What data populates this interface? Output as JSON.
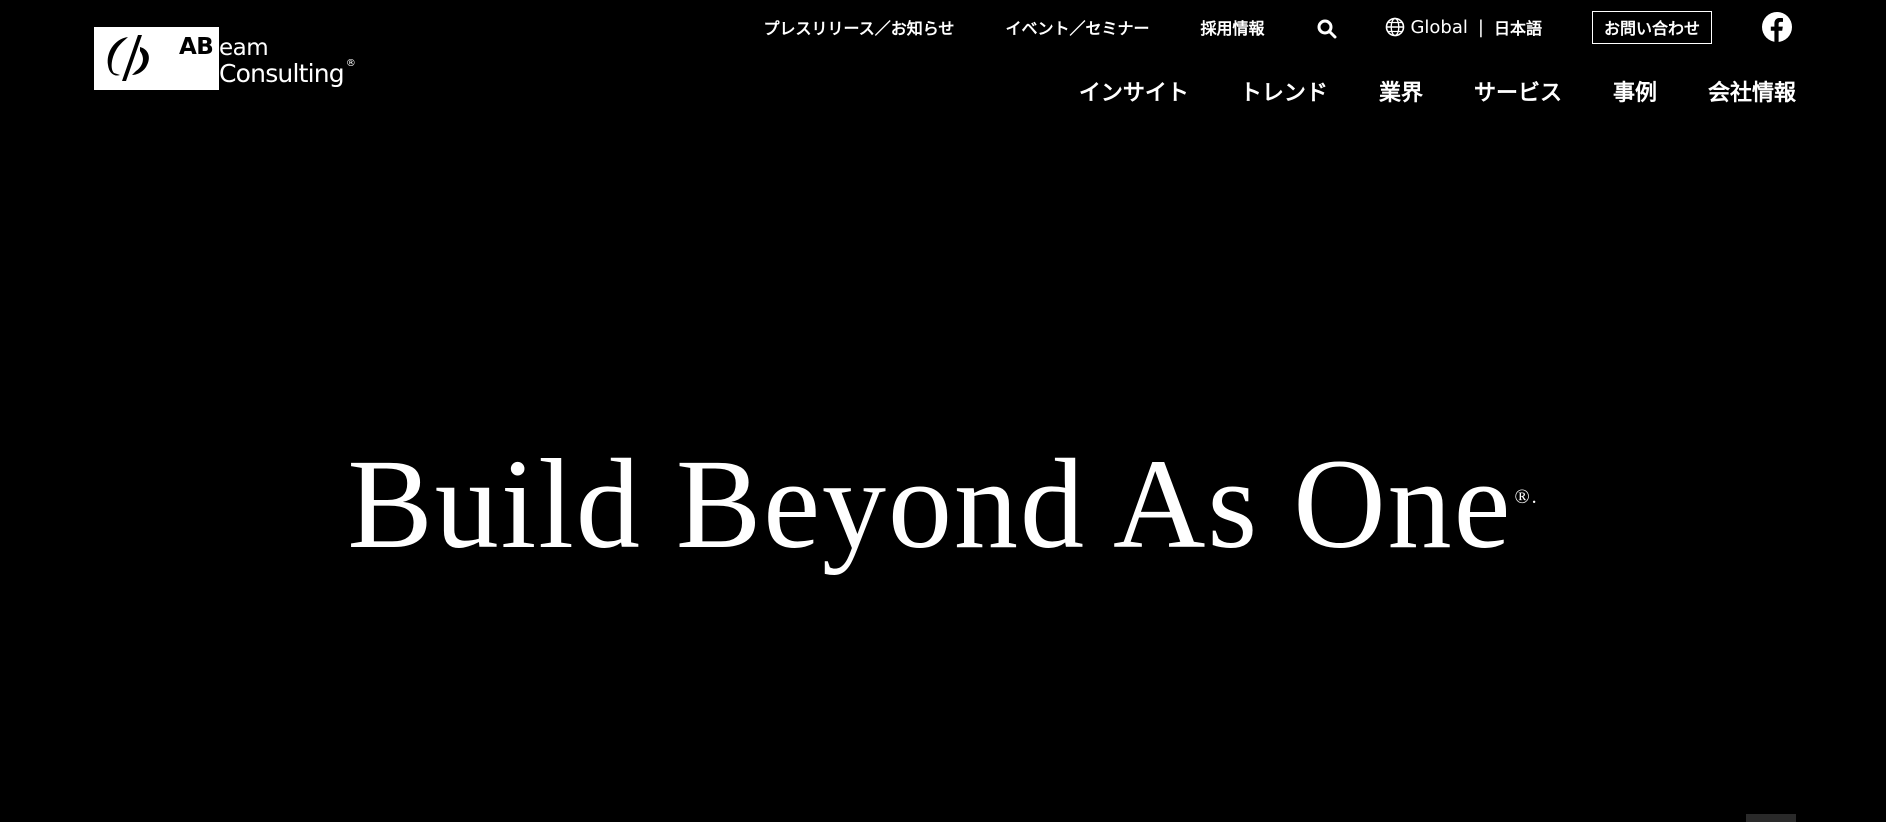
{
  "header": {
    "logo": {
      "ab": "AB",
      "eam": "eam",
      "consulting": "Consulting",
      "registered": "®"
    },
    "utility_nav": {
      "press": "プレスリリース／お知らせ",
      "events": "イベント／セミナー",
      "careers": "採用情報",
      "search_icon": "search-icon",
      "language": {
        "global": "Global",
        "separator": "|",
        "current": "日本語"
      },
      "contact": "お問い合わせ",
      "social_icon": "facebook-icon"
    },
    "main_nav": [
      {
        "label": "インサイト"
      },
      {
        "label": "トレンド"
      },
      {
        "label": "業界"
      },
      {
        "label": "サービス"
      },
      {
        "label": "事例"
      },
      {
        "label": "会社情報"
      }
    ]
  },
  "hero": {
    "tagline": "Build Beyond As One",
    "mark": "®."
  },
  "colors": {
    "background": "#000000",
    "text": "#ffffff"
  }
}
